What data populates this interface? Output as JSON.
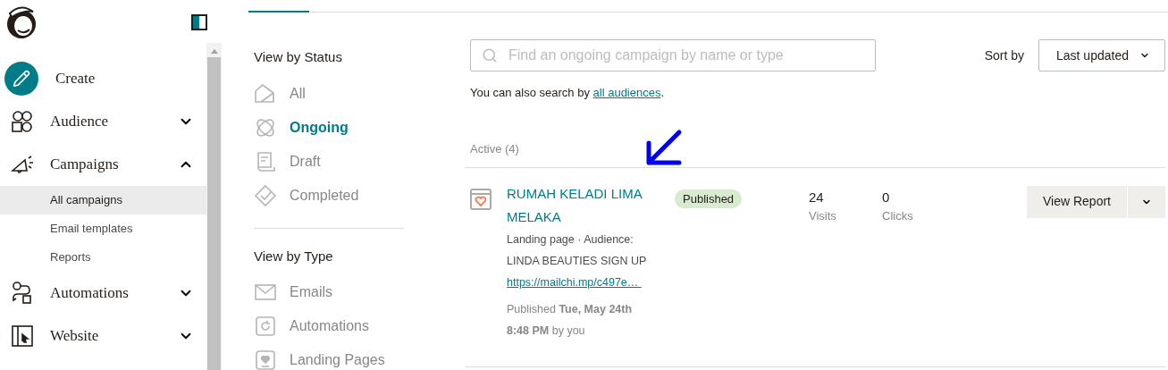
{
  "sidebar": {
    "items": [
      {
        "label": "Create",
        "kind": "create"
      },
      {
        "label": "Audience",
        "kind": "section",
        "expanded": false
      },
      {
        "label": "Campaigns",
        "kind": "section",
        "expanded": true,
        "children": [
          {
            "label": "All campaigns",
            "selected": true
          },
          {
            "label": "Email templates",
            "selected": false
          },
          {
            "label": "Reports",
            "selected": false
          }
        ]
      },
      {
        "label": "Automations",
        "kind": "section",
        "expanded": false
      },
      {
        "label": "Website",
        "kind": "section",
        "expanded": false
      }
    ]
  },
  "tabs": [
    {
      "selected": true
    }
  ],
  "filters": [
    {
      "heading": "View by Status",
      "items": [
        {
          "label": "All",
          "selected": false
        },
        {
          "label": "Ongoing",
          "selected": true
        },
        {
          "label": "Draft",
          "selected": false
        },
        {
          "label": "Completed",
          "selected": false
        }
      ]
    },
    {
      "heading": "View by Type",
      "items": [
        {
          "label": "Emails",
          "selected": false
        },
        {
          "label": "Automations",
          "selected": false
        },
        {
          "label": "Landing Pages",
          "selected": false
        }
      ]
    }
  ],
  "search": {
    "placeholder": "Find an ongoing campaign by name or type",
    "hint": "You can also search by ",
    "hint_link": "all audiences",
    "hint_end": "."
  },
  "sort": {
    "label": "Sort by",
    "value": "Last updated"
  },
  "group": {
    "title": "Active (4)"
  },
  "campaigns": [
    {
      "title": "RUMAH KELADI LIMA MELAKA",
      "status": "Published",
      "meta": "Landing page · Audience:",
      "audience": "LINDA BEAUTIES SIGN UP",
      "url": "https://mailchi.mp/c497e… ",
      "published": "Published **Tue, May 24th 8:48 PM** by you",
      "stats": [
        {
          "value": "24",
          "label": "Visits"
        },
        {
          "value": "0",
          "label": "Clicks"
        }
      ],
      "action": "View Report"
    }
  ]
}
